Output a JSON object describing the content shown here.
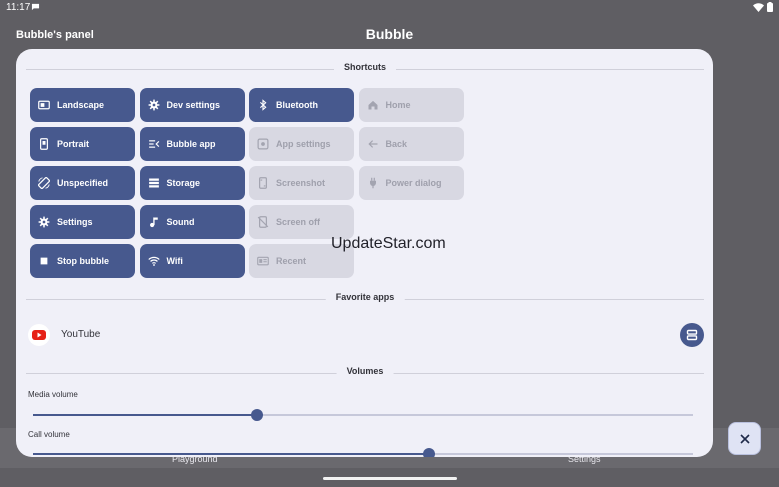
{
  "status_bar": {
    "time": "11:17"
  },
  "app_bar": {
    "panel_title": "Bubble's panel",
    "app_title": "Bubble"
  },
  "background_tabs": [
    "Playground",
    "Settings"
  ],
  "sections": {
    "shortcuts": "Shortcuts",
    "favorite_apps": "Favorite apps",
    "volumes": "Volumes"
  },
  "shortcuts": [
    {
      "label": "Landscape",
      "icon": "landscape-icon",
      "active": true
    },
    {
      "label": "Dev settings",
      "icon": "gear-icon",
      "active": true
    },
    {
      "label": "Bluetooth",
      "icon": "bluetooth-icon",
      "active": true
    },
    {
      "label": "Home",
      "icon": "home-icon",
      "active": false
    },
    {
      "label": "Portrait",
      "icon": "portrait-icon",
      "active": true
    },
    {
      "label": "Bubble app",
      "icon": "menu-open-icon",
      "active": true
    },
    {
      "label": "App settings",
      "icon": "app-settings-icon",
      "active": false
    },
    {
      "label": "Back",
      "icon": "back-arrow-icon",
      "active": false
    },
    {
      "label": "Unspecified",
      "icon": "screen-rotation-icon",
      "active": true
    },
    {
      "label": "Storage",
      "icon": "storage-icon",
      "active": true
    },
    {
      "label": "Screenshot",
      "icon": "screenshot-icon",
      "active": false
    },
    {
      "label": "Power dialog",
      "icon": "power-plug-icon",
      "active": false
    },
    {
      "label": "Settings",
      "icon": "gear-icon",
      "active": true
    },
    {
      "label": "Sound",
      "icon": "music-note-icon",
      "active": true
    },
    {
      "label": "Screen off",
      "icon": "screen-off-icon",
      "active": false
    },
    {
      "label": "Stop bubble",
      "icon": "stop-icon",
      "active": true
    },
    {
      "label": "Wifi",
      "icon": "wifi-icon",
      "active": true
    },
    {
      "label": "Recent",
      "icon": "recent-apps-icon",
      "active": false
    }
  ],
  "favorite_apps": [
    {
      "name": "YouTube",
      "icon": "youtube-logo"
    }
  ],
  "volumes": [
    {
      "label": "Media volume",
      "level": 0.34
    },
    {
      "label": "Call volume",
      "level": 0.6
    }
  ],
  "watermark": "UpdateStar.com",
  "colors": {
    "accent": "#47598e",
    "inactive": "#d8d8e2",
    "sheet": "#f0f0f8",
    "scrim": "#5f5e63"
  }
}
